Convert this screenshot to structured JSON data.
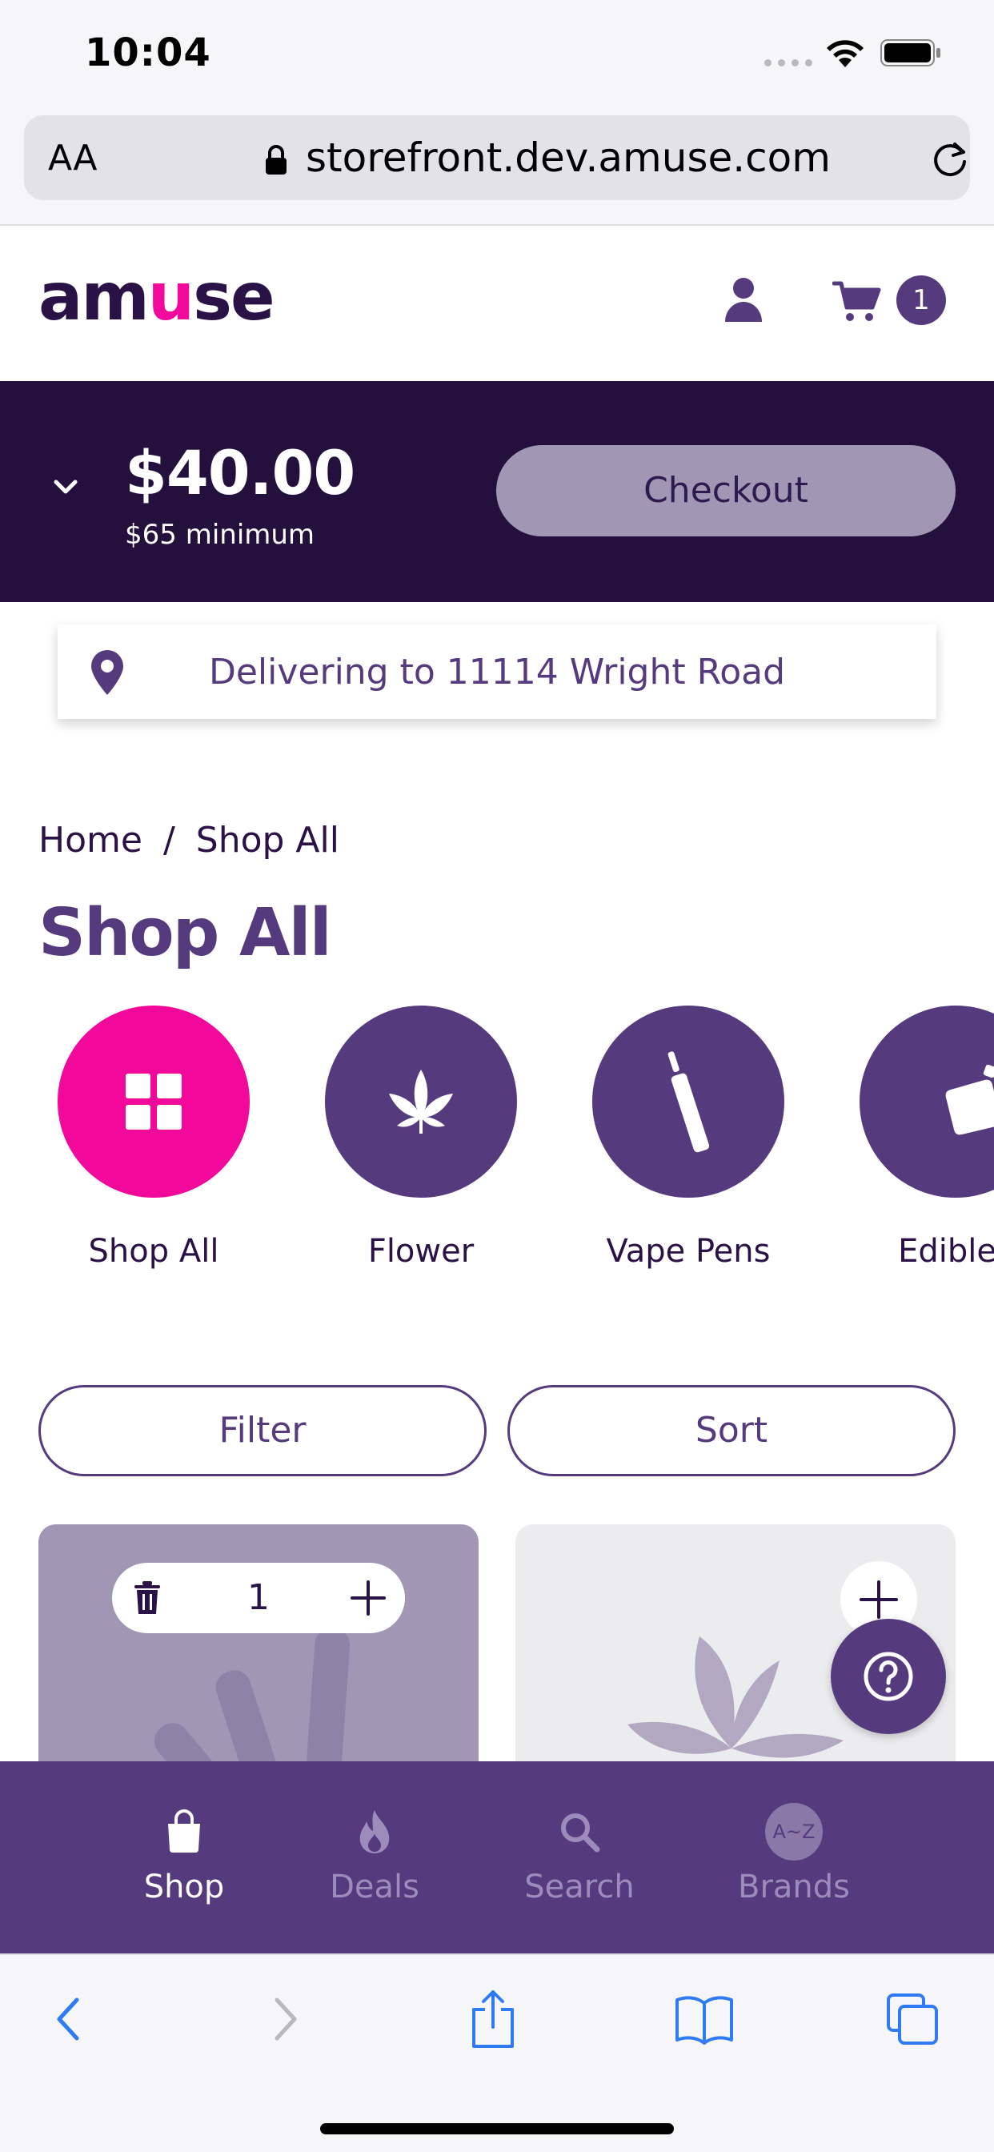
{
  "status_bar": {
    "time": "10:04"
  },
  "browser": {
    "text_size_label": "AA",
    "url": "storefront.dev.amuse.com"
  },
  "header": {
    "logo": {
      "part1": "am",
      "part2": "u",
      "part3": "se"
    },
    "cart_count": "1"
  },
  "cart_summary": {
    "total": "$40.00",
    "minimum": "$65 minimum",
    "checkout_label": "Checkout"
  },
  "delivery": {
    "text": "Delivering to 11114 Wright Road"
  },
  "breadcrumb": {
    "home": "Home",
    "separator": "/",
    "current": "Shop All"
  },
  "page_title": "Shop All",
  "categories": [
    {
      "label": "Shop All",
      "icon": "grid-icon",
      "active": true
    },
    {
      "label": "Flower",
      "icon": "leaf-icon"
    },
    {
      "label": "Vape Pens",
      "icon": "vape-pen-icon"
    },
    {
      "label": "Edibles",
      "icon": "edibles-icon"
    }
  ],
  "controls": {
    "filter_label": "Filter",
    "sort_label": "Sort"
  },
  "products": [
    {
      "quantity": "1"
    },
    {}
  ],
  "bottom_nav": [
    {
      "label": "Shop",
      "icon": "shopping-bag-icon",
      "active": true
    },
    {
      "label": "Deals",
      "icon": "flame-icon"
    },
    {
      "label": "Search",
      "icon": "search-icon"
    },
    {
      "label": "Brands",
      "icon": "brands-az-icon",
      "badge": "A~Z"
    }
  ],
  "colors": {
    "primary_purple": "#553b7e",
    "dark_purple": "#23103d",
    "accent_pink": "#f2089b",
    "checkout_button": "#a296b5"
  }
}
